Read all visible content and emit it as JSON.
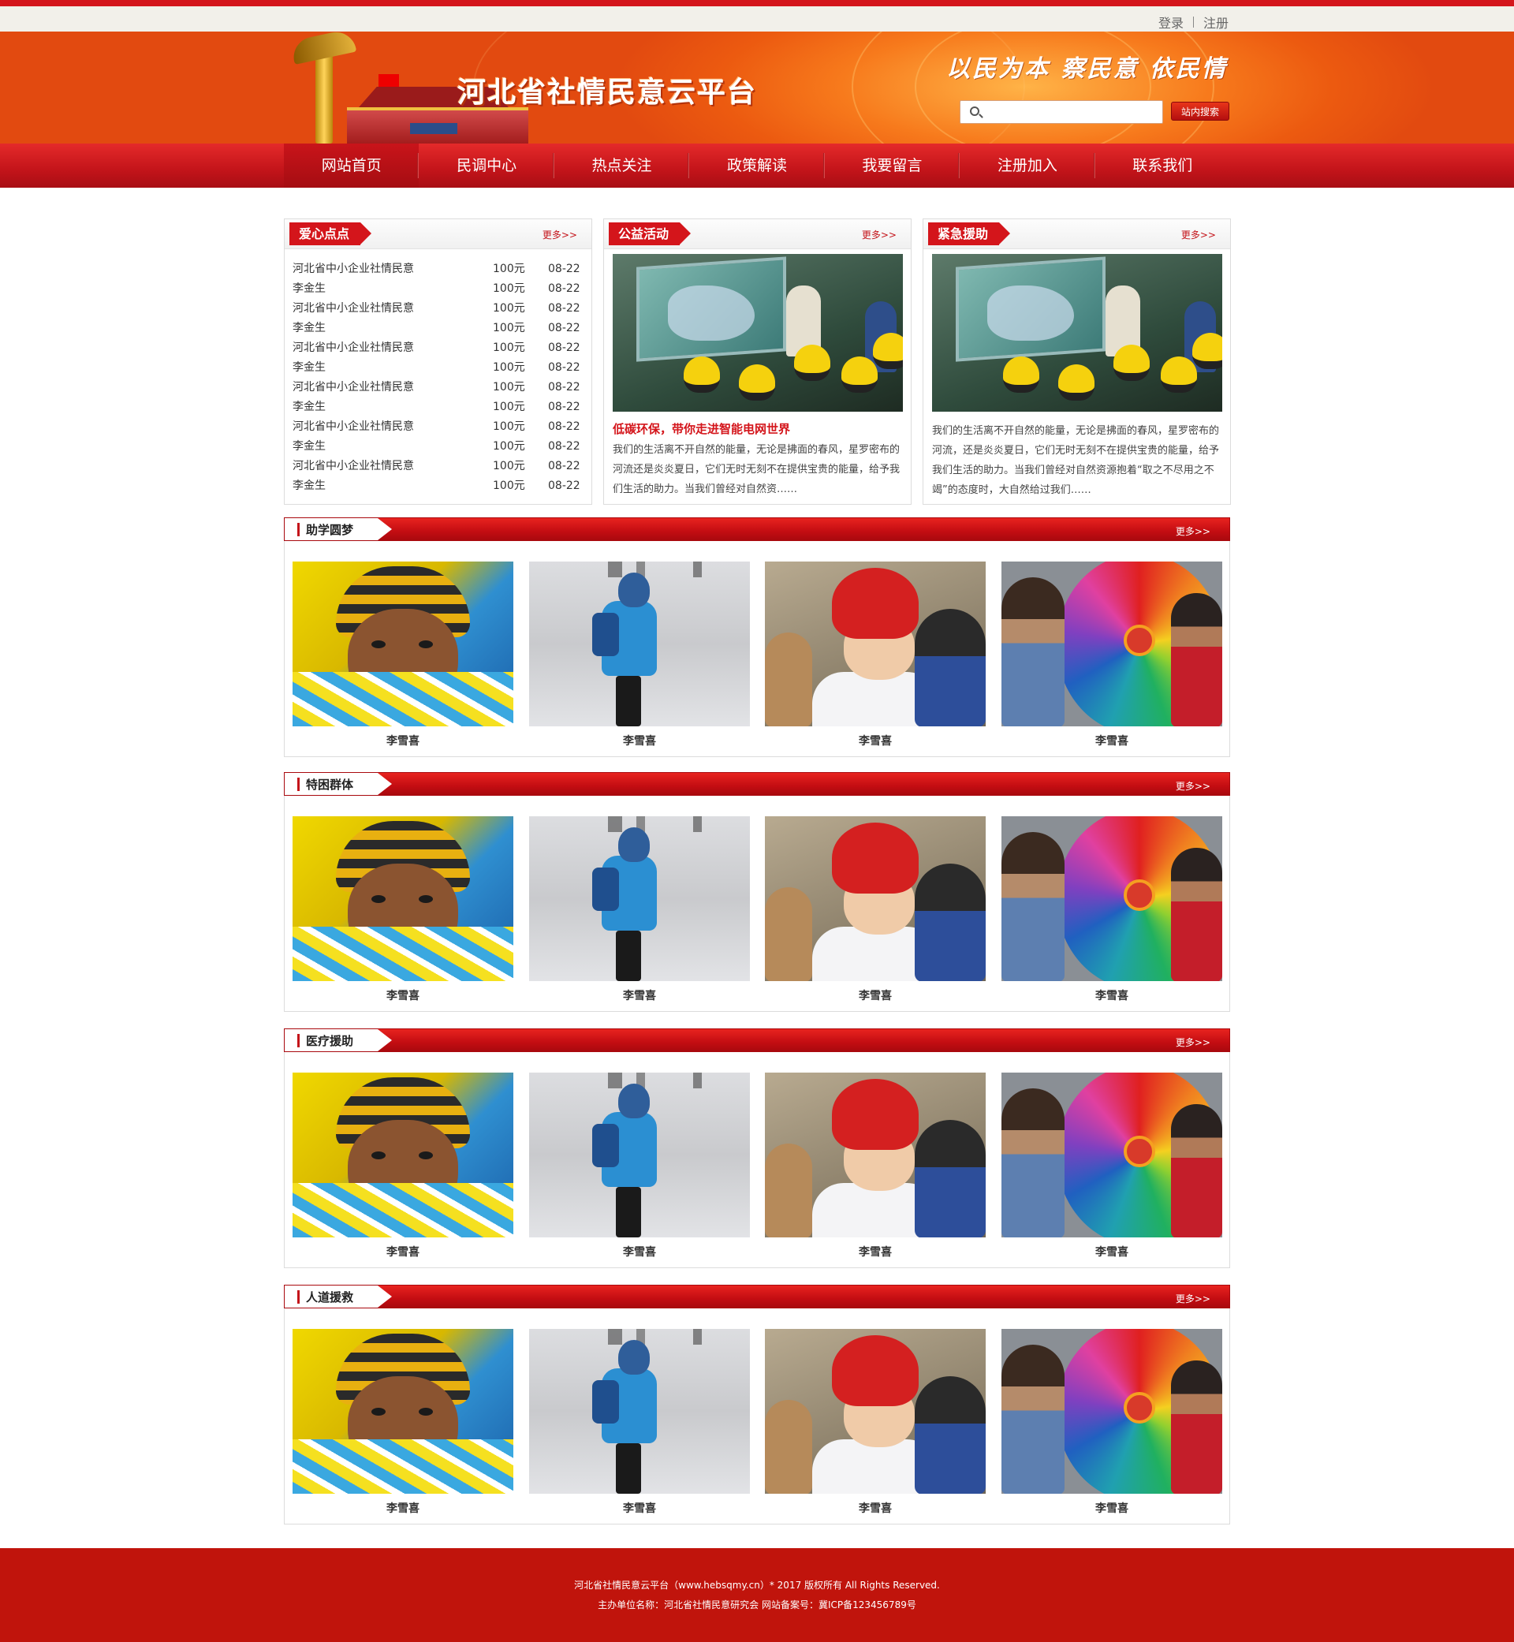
{
  "topbar": {
    "login": "登录",
    "register": "注册"
  },
  "header": {
    "title": "河北省社情民意云平台",
    "slogan": "以民为本 察民意 依民情",
    "search_placeholder": "",
    "search_button": "站内搜索"
  },
  "nav": {
    "items": [
      "网站首页",
      "民调中心",
      "热点关注",
      "政策解读",
      "我要留言",
      "注册加入",
      "联系我们"
    ]
  },
  "more_label": "更多>>",
  "boxes": {
    "love": {
      "title": "爱心点点",
      "rows": [
        {
          "name": "河北省中小企业社情民意",
          "amount": "100元",
          "date": "08-22"
        },
        {
          "name": "李金生",
          "amount": "100元",
          "date": "08-22"
        },
        {
          "name": "河北省中小企业社情民意",
          "amount": "100元",
          "date": "08-22"
        },
        {
          "name": "李金生",
          "amount": "100元",
          "date": "08-22"
        },
        {
          "name": "河北省中小企业社情民意",
          "amount": "100元",
          "date": "08-22"
        },
        {
          "name": "李金生",
          "amount": "100元",
          "date": "08-22"
        },
        {
          "name": "河北省中小企业社情民意",
          "amount": "100元",
          "date": "08-22"
        },
        {
          "name": "李金生",
          "amount": "100元",
          "date": "08-22"
        },
        {
          "name": "河北省中小企业社情民意",
          "amount": "100元",
          "date": "08-22"
        },
        {
          "name": "李金生",
          "amount": "100元",
          "date": "08-22"
        },
        {
          "name": "河北省中小企业社情民意",
          "amount": "100元",
          "date": "08-22"
        },
        {
          "name": "李金生",
          "amount": "100元",
          "date": "08-22"
        }
      ]
    },
    "charity": {
      "title": "公益活动",
      "headline": "低碳环保，带你走进智能电网世界",
      "text": "我们的生活离不开自然的能量，无论是拂面的春风，星罗密布的河流还是炎炎夏日，它们无时无刻不在提供宝贵的能量，给予我们生活的助力。当我们曾经对自然资……"
    },
    "emergency": {
      "title": "紧急援助",
      "text": "我们的生活离不开自然的能量，无论是拂面的春风，星罗密布的河流，还是炎炎夏日，它们无时无刻不在提供宝贵的能量，给予我们生活的助力。当我们曾经对自然资源抱着“取之不尽用之不竭”的态度时，大自然给过我们……"
    }
  },
  "sections": [
    {
      "title": "助学圆梦",
      "captions": [
        "李雪喜",
        "李雪喜",
        "李雪喜",
        "李雪喜"
      ]
    },
    {
      "title": "特困群体",
      "captions": [
        "李雪喜",
        "李雪喜",
        "李雪喜",
        "李雪喜"
      ]
    },
    {
      "title": "医疗援助",
      "captions": [
        "李雪喜",
        "李雪喜",
        "李雪喜",
        "李雪喜"
      ]
    },
    {
      "title": "人道援救",
      "captions": [
        "李雪喜",
        "李雪喜",
        "李雪喜",
        "李雪喜"
      ]
    }
  ],
  "footer": {
    "line1": "河北省社情民意云平台（www.hebsqmy.cn）* 2017 版权所有 All Rights Reserved.",
    "line2": "主办单位名称：河北省社情民意研究会    网站备案号：冀ICP备123456789号"
  },
  "colors": {
    "brand_red": "#d4151b",
    "header_orange": "#ec5a10",
    "footer_red": "#c0140c"
  }
}
